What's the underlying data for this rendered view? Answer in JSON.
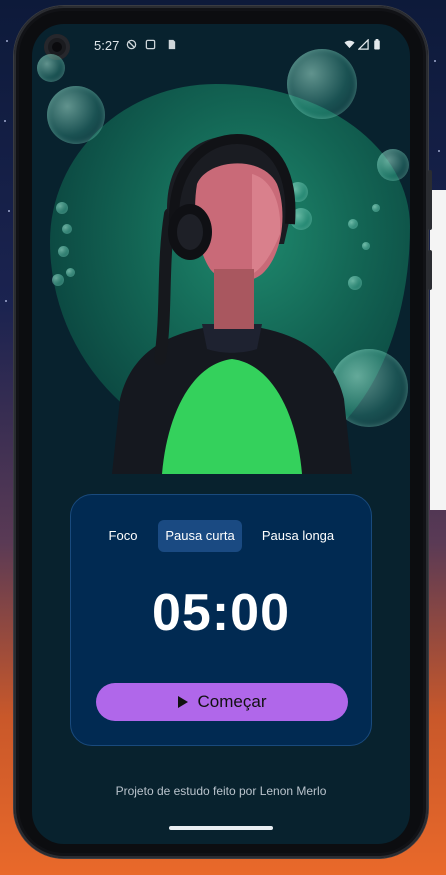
{
  "status_bar": {
    "time": "5:27"
  },
  "timer_card": {
    "tabs": [
      {
        "label": "Foco",
        "active": false
      },
      {
        "label": "Pausa curta",
        "active": true
      },
      {
        "label": "Pausa longa",
        "active": false
      }
    ],
    "time_display": "05:00",
    "start_button_label": "Começar"
  },
  "footer": {
    "credit": "Projeto de estudo feito por Lenon Merlo"
  },
  "colors": {
    "card_bg": "#012a52",
    "active_tab_bg": "#1a4a82",
    "start_button": "#b067ea",
    "screen_bg": "#08222e",
    "blob_green": "#136554"
  }
}
